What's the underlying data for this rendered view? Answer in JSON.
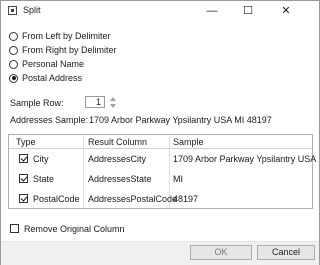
{
  "window": {
    "title": "Split",
    "minimize_glyph": "—",
    "maximize_glyph": "☐",
    "close_glyph": "✕"
  },
  "modes": [
    {
      "label": "From Left by Delimiter",
      "checked": false
    },
    {
      "label": "From Right by Delimiter",
      "checked": false
    },
    {
      "label": "Personal Name",
      "checked": false
    },
    {
      "label": "Postal Address",
      "checked": true
    }
  ],
  "sample_row": {
    "label": "Sample Row:",
    "value": "1"
  },
  "addresses_sample": {
    "label": "Addresses Sample:",
    "value": "1709 Arbor Parkway Ypsilantry USA MI 48197"
  },
  "grid": {
    "headers": [
      "Type",
      "Result Column",
      "Sample"
    ],
    "rows": [
      {
        "type": "City",
        "result": "AddressesCity",
        "sample": "1709 Arbor Parkway Ypsilantry USA",
        "checked": true
      },
      {
        "type": "State",
        "result": "AddressesState",
        "sample": "MI",
        "checked": true
      },
      {
        "type": "PostalCode",
        "result": "AddressesPostalCode",
        "sample": "48197",
        "checked": true
      }
    ]
  },
  "remove_original": {
    "label": "Remove Original Column",
    "checked": false
  },
  "buttons": {
    "ok": "OK",
    "cancel": "Cancel"
  }
}
